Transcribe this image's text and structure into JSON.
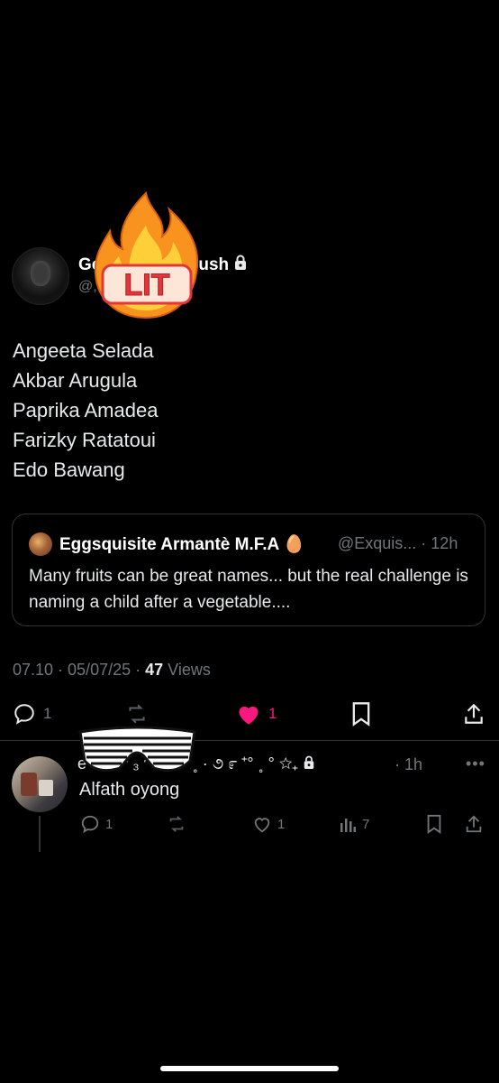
{
  "tweet": {
    "display_name_start": "Ge",
    "display_name_end": "ush",
    "handle": "@,",
    "sticker": "LIT",
    "lines": [
      "Angeeta Selada",
      "Akbar Arugula",
      "Paprika Amadea",
      "Farizky Ratatoui",
      "Edo Bawang"
    ],
    "timestamp": "07.10 · 05/07/25 · ",
    "views_count": "47",
    "views_label": " Views"
  },
  "quote": {
    "name": "Eggsquisite Armantè M.F.A",
    "badge": "🥚",
    "handle_time": "@Exquis... · 12h",
    "text": "Many fruits can be great names... but the real challenge is naming a child after a vegetable...."
  },
  "actions": {
    "reply_count": "1",
    "like_count": "1",
    "like_color": "#f91880"
  },
  "reply": {
    "name": "e ᓚ    ʚ ᵔ ₃ ᵔ ʚ ̊  ·  ° ˳ · ૭ ೯ ⁺° ˳ ° ☆₊ ",
    "time": "· 1h",
    "more": "•••",
    "text": "Alfath oyong",
    "reply_count": "1",
    "like_count": "1",
    "views_count": "7"
  }
}
